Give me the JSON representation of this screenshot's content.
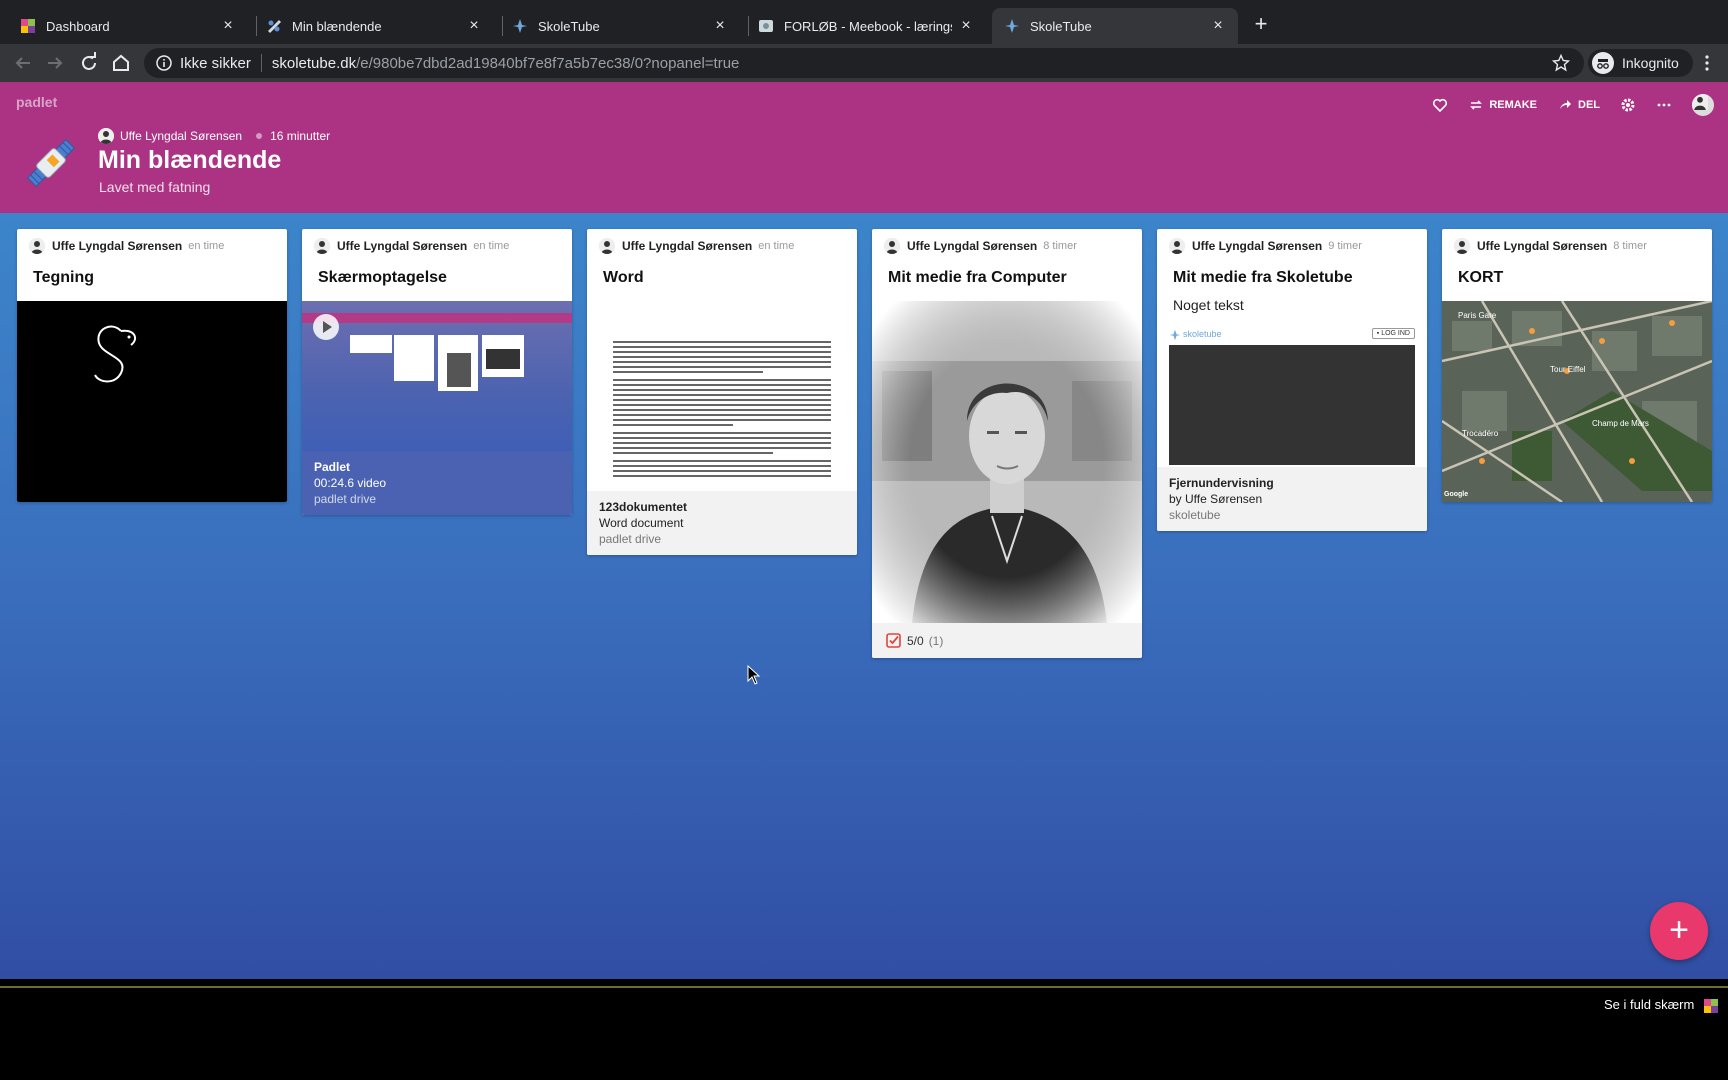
{
  "browser": {
    "tabs": [
      {
        "label": "Dashboard",
        "icon": "meebook-icon"
      },
      {
        "label": "Min blændende",
        "icon": "padlet-icon"
      },
      {
        "label": "SkoleTube",
        "icon": "skoletube-icon"
      },
      {
        "label": "FORLØB - Meebook - læringspla",
        "icon": "meebook-page-icon"
      },
      {
        "label": "SkoleTube",
        "icon": "skoletube-icon"
      }
    ],
    "address": {
      "security_label": "Ikke sikker",
      "host": "skoletube.dk",
      "path": "/e/980be7dbd2ad19840bf7e8f7a5b7ec38/0?nopanel=true"
    },
    "profile_label": "Inkognito"
  },
  "padlet": {
    "brand": "padlet",
    "actions": {
      "remake": "REMAKE",
      "share": "DEL"
    },
    "author": "Uffe Lyngdal Sørensen",
    "age": "16 minutter",
    "title": "Min blændende",
    "subtitle": "Lavet med fatning",
    "colors": {
      "header": "#ac3383",
      "fab": "#e9386b"
    }
  },
  "cards": [
    {
      "author": "Uffe Lyngdal Sørensen",
      "time": "en time",
      "title": "Tegning"
    },
    {
      "author": "Uffe Lyngdal Sørensen",
      "time": "en time",
      "title": "Skærmoptagelse",
      "attachment": {
        "title": "Padlet",
        "desc": "00:24.6 video",
        "source": "padlet drive"
      }
    },
    {
      "author": "Uffe Lyngdal Sørensen",
      "time": "en time",
      "title": "Word",
      "attachment": {
        "title": "123dokumentet",
        "desc": "Word document",
        "source": "padlet drive"
      }
    },
    {
      "author": "Uffe Lyngdal Sørensen",
      "time": "8 timer",
      "title": "Mit medie fra Computer",
      "rating": {
        "score": "5/0",
        "count": "(1)"
      }
    },
    {
      "author": "Uffe Lyngdal Sørensen",
      "time": "9 timer",
      "title": "Mit medie fra Skoletube",
      "body": "Noget tekst",
      "embed": {
        "brand": "skoletube",
        "login": "LOG IND"
      },
      "attachment": {
        "title": "Fjernundervisning",
        "desc": "by Uffe Sørensen",
        "source": "skoletube"
      }
    },
    {
      "author": "Uffe Lyngdal Sørensen",
      "time": "8 timer",
      "title": "KORT",
      "map": {
        "labels": [
          "Paris Gare",
          "Tour Eiffel",
          "Champ de Mars",
          "Trocadéro",
          "Google"
        ]
      }
    }
  ],
  "footer": {
    "fullscreen": "Se i fuld skærm"
  }
}
